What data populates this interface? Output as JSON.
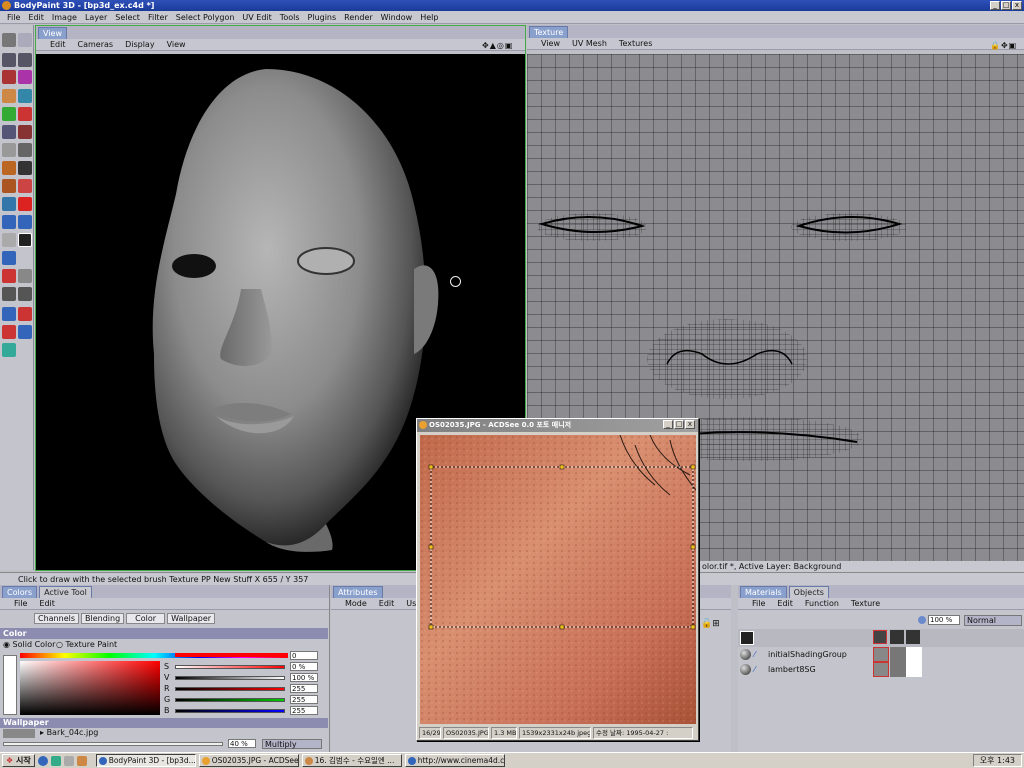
{
  "window": {
    "title": "BodyPaint 3D - [bp3d_ex.c4d *]"
  },
  "menubar": [
    "File",
    "Edit",
    "Image",
    "Layer",
    "Select",
    "Filter",
    "Select Polygon",
    "UV Edit",
    "Tools",
    "Plugins",
    "Render",
    "Window",
    "Help"
  ],
  "view_pane": {
    "tab": "View",
    "menu": [
      "Edit",
      "Cameras",
      "Display",
      "View"
    ]
  },
  "texture_pane": {
    "tab": "Texture",
    "menu": [
      "View",
      "UV Mesh",
      "Textures"
    ],
    "status": "olor.tif *, Active Layer: Background"
  },
  "status_bar": {
    "text": "Click to draw with the selected brush  Texture PP New Stuff  X 655 / Y 357"
  },
  "colors_panel": {
    "tabs": [
      "Colors",
      "Active Tool"
    ],
    "menu": [
      "File",
      "Edit"
    ],
    "subtabs": [
      "Channels",
      "Blending",
      "Color",
      "Wallpaper"
    ],
    "section": "Color",
    "mode_solid": "Solid Color",
    "mode_texture": "Texture Paint",
    "sliders": [
      {
        "label": "",
        "value": "0"
      },
      {
        "label": "S",
        "value": "0 %"
      },
      {
        "label": "V",
        "value": "100 %"
      },
      {
        "label": "R",
        "value": "255"
      },
      {
        "label": "G",
        "value": "255"
      },
      {
        "label": "B",
        "value": "255"
      }
    ],
    "wallpaper_label": "Wallpaper",
    "wallpaper_file": "Bark_04c.jpg",
    "opacity": "40 %",
    "blend": "Multiply",
    "hue_color": "#ff0000"
  },
  "attributes_panel": {
    "tab": "Attributes",
    "menu": [
      "Mode",
      "Edit",
      "Use"
    ]
  },
  "materials_panel": {
    "tabs": [
      "Materials",
      "Objects"
    ],
    "menu": [
      "File",
      "Edit",
      "Function",
      "Texture"
    ],
    "opacity": "100 %",
    "blend": "Normal",
    "items": [
      "initialShadingGroup",
      "lambert8SG"
    ]
  },
  "acdsee": {
    "title": "OS02035.JPG - ACDSee 0.0 포토 매니저",
    "status": [
      "16/29",
      "OS02035.JPG",
      "1.3 MB",
      "1539x2331x24b jpeg",
      "수정 날짜: 1995-04-27 :"
    ]
  },
  "taskbar": {
    "start": "시작",
    "tasks": [
      "BodyPaint 3D - [bp3d...",
      "OS02035.JPG - ACDSee ...",
      "16. 김범수 - 수요일엔 ...",
      "http://www.cinema4d.co..."
    ],
    "clock": "오후 1:43"
  }
}
